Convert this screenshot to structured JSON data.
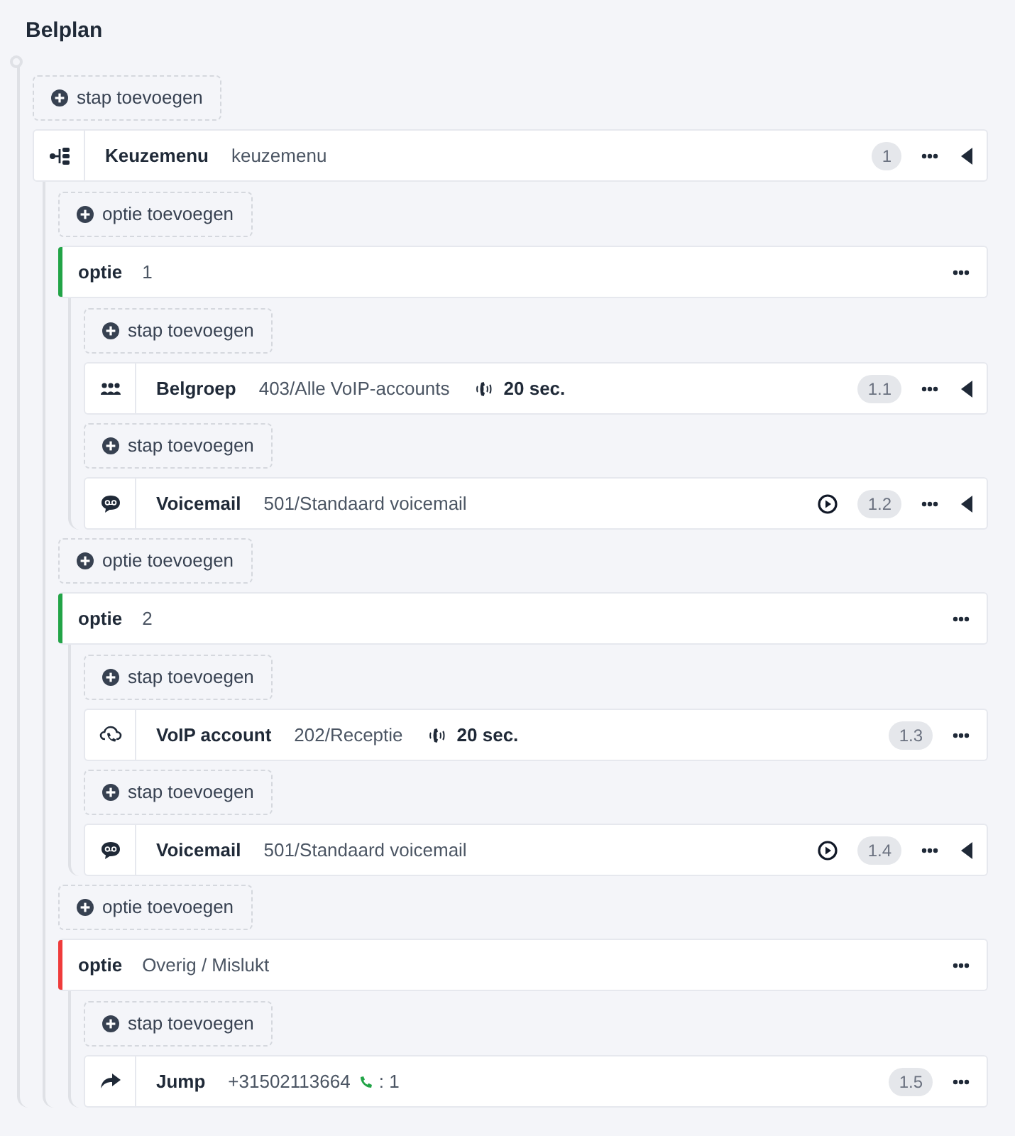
{
  "title": "Belplan",
  "items": [
    {
      "kind": "add",
      "label": "stap toevoegen"
    },
    {
      "kind": "menu",
      "name": "Keuzemenu",
      "detail": "keuzemenu",
      "badge": "1",
      "collapse_toggle": true,
      "children": [
        {
          "kind": "add",
          "label": "optie toevoegen"
        },
        {
          "kind": "option",
          "label": "optie",
          "value": "1",
          "color": "#22a447",
          "children": [
            {
              "kind": "add",
              "label": "stap toevoegen"
            },
            {
              "kind": "group",
              "name": "Belgroep",
              "detail": "403/Alle VoIP-accounts",
              "ring_time": "20 sec.",
              "badge": "1.1",
              "collapse_toggle": true
            },
            {
              "kind": "add",
              "label": "stap toevoegen"
            },
            {
              "kind": "voicemail",
              "name": "Voicemail",
              "detail": "501/Standaard voicemail",
              "play": true,
              "badge": "1.2",
              "collapse_toggle": true
            }
          ]
        },
        {
          "kind": "add",
          "label": "optie toevoegen"
        },
        {
          "kind": "option",
          "label": "optie",
          "value": "2",
          "color": "#22a447",
          "children": [
            {
              "kind": "add",
              "label": "stap toevoegen"
            },
            {
              "kind": "account",
              "name": "VoIP account",
              "detail": "202/Receptie",
              "ring_time": "20 sec.",
              "badge": "1.3",
              "collapse_toggle": false
            },
            {
              "kind": "add",
              "label": "stap toevoegen"
            },
            {
              "kind": "voicemail",
              "name": "Voicemail",
              "detail": "501/Standaard voicemail",
              "play": true,
              "badge": "1.4",
              "collapse_toggle": true
            }
          ]
        },
        {
          "kind": "add",
          "label": "optie toevoegen"
        },
        {
          "kind": "option",
          "label": "optie",
          "value": "Overig / Mislukt",
          "color": "#ef3b3b",
          "children": [
            {
              "kind": "add",
              "label": "stap toevoegen"
            },
            {
              "kind": "jump",
              "name": "Jump",
              "detail": "+31502113664",
              "phone_suffix": ": 1",
              "badge": "1.5",
              "collapse_toggle": false
            }
          ]
        }
      ]
    }
  ]
}
